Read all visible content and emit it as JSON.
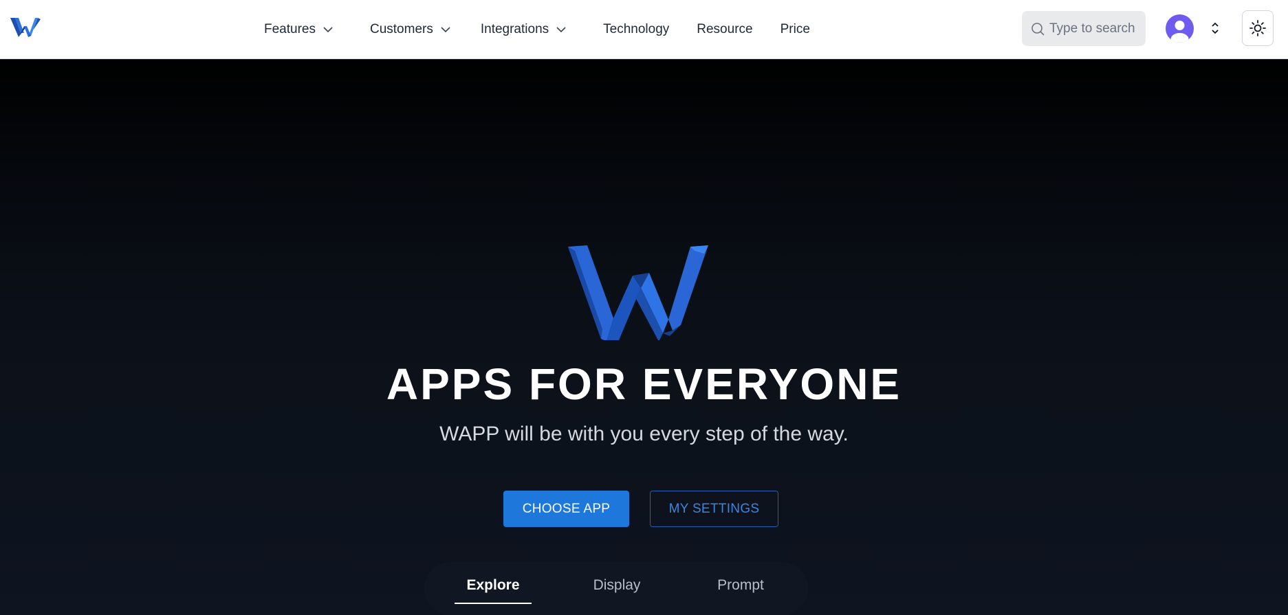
{
  "header": {
    "nav": {
      "features": "Features",
      "customers": "Customers",
      "integrations": "Integrations",
      "technology": "Technology",
      "resource": "Resource",
      "price": "Price"
    },
    "search": {
      "placeholder": "Type to search"
    }
  },
  "hero": {
    "title": "APPS FOR EVERYONE",
    "subtitle": "WAPP will be with you every step of the way.",
    "primary_button": "CHOOSE APP",
    "secondary_button": "MY SETTINGS",
    "tabs": [
      "Explore",
      "Display",
      "Prompt"
    ],
    "active_tab": "Explore"
  },
  "colors": {
    "brand_blue": "#1e78dc",
    "avatar": "#6e5bf0",
    "hero_bg": "#0b1018"
  },
  "icons": [
    "logo-icon",
    "chevron-down-icon",
    "search-icon",
    "user-icon",
    "chevron-updown-icon",
    "sun-icon"
  ]
}
